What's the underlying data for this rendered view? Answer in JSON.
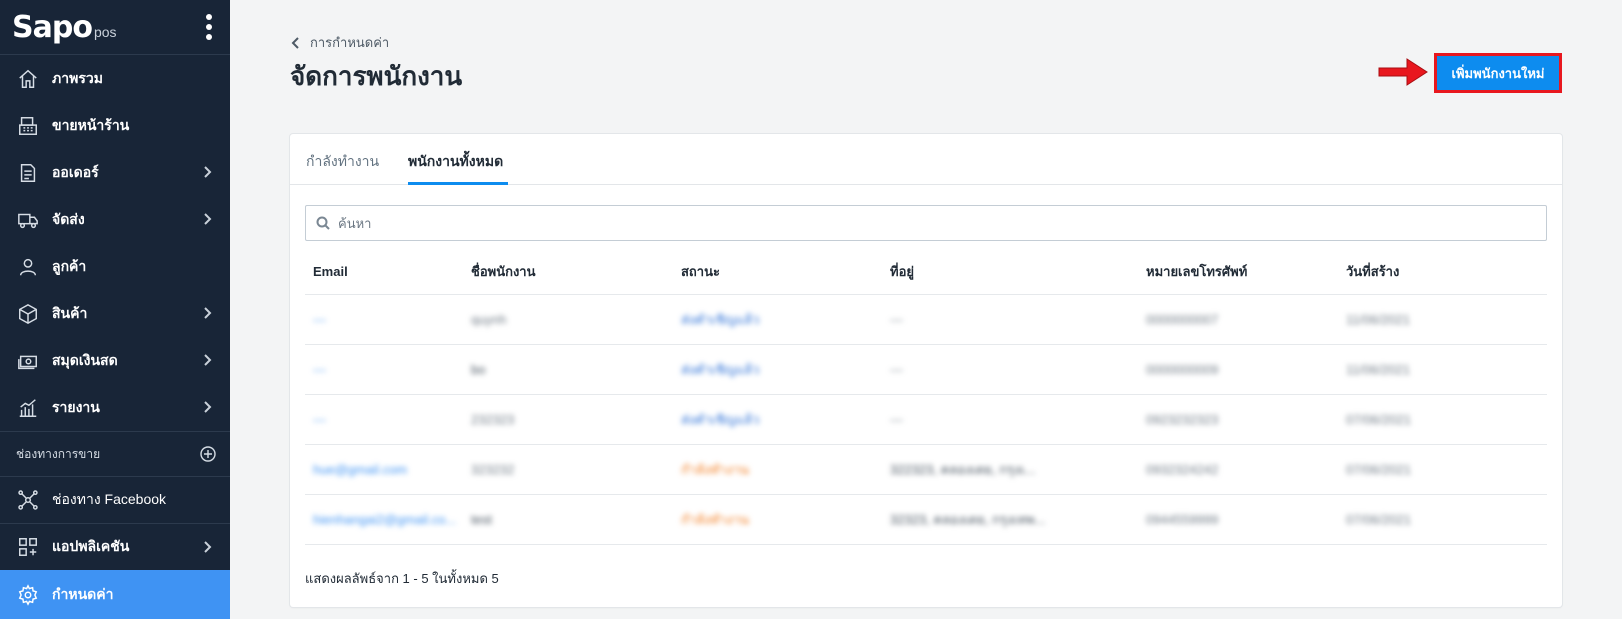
{
  "sidebar": {
    "logo_main": "Sapo",
    "logo_sub": "pos",
    "items": [
      {
        "label": "ภาพรวม"
      },
      {
        "label": "ขายหน้าร้าน"
      },
      {
        "label": "ออเดอร์"
      },
      {
        "label": "จัดส่ง"
      },
      {
        "label": "ลูกค้า"
      },
      {
        "label": "สินค้า"
      },
      {
        "label": "สมุดเงินสด"
      },
      {
        "label": "รายงาน"
      }
    ],
    "channels_header": "ช่องทางการขาย",
    "facebook_label": "ช่องทาง Facebook",
    "apps_label": "แอปพลิเคชัน",
    "settings_label": "กำหนดค่า"
  },
  "header": {
    "breadcrumb": "การกำหนดค่า",
    "title": "จัดการพนักงาน",
    "add_button": "เพิ่มพนักงานใหม่"
  },
  "tabs": {
    "working": "กำลังทำงาน",
    "all": "พนักงานทั้งหมด"
  },
  "search": {
    "placeholder": "ค้นหา"
  },
  "table": {
    "columns": [
      "Email",
      "ชื่อพนักงาน",
      "สถานะ",
      "ที่อยู่",
      "หมายเลขโทรศัพท์",
      "วันที่สร้าง"
    ],
    "rows": [
      {
        "email": "---",
        "name": "quynh",
        "status": "ส่งคำเชิญแล้ว",
        "address": "---",
        "phone": "0000000007",
        "created": "11/06/2021"
      },
      {
        "email": "---",
        "name": "bo",
        "status": "ส่งคำเชิญแล้ว",
        "address": "---",
        "phone": "0000000009",
        "created": "11/06/2021"
      },
      {
        "email": "---",
        "name": "232323",
        "status": "ส่งคำเชิญแล้ว",
        "address": "---",
        "phone": "0923232323",
        "created": "07/06/2021"
      },
      {
        "email": "hue@gmail.com",
        "name": "323232",
        "status": "กำลังทำงาน",
        "address": "322323, คลองเตย, กรุงเ...",
        "phone": "0932324242",
        "created": "07/06/2021"
      },
      {
        "email": "hienhangai2@gmail.co...",
        "name": "test",
        "status": "กำลังทำงาน",
        "address": "32323, คลองเตย, กรุงเทพ...",
        "phone": "0944559999",
        "created": "07/06/2021"
      }
    ]
  },
  "footer": {
    "summary": "แสดงผลลัพธ์จาก 1 - 5 ในทั้งหมด 5"
  },
  "colors": {
    "sidebar_bg": "#182537",
    "active": "#3f93f3",
    "primary_button": "#0d8cef",
    "highlight_border": "#e8171e"
  }
}
